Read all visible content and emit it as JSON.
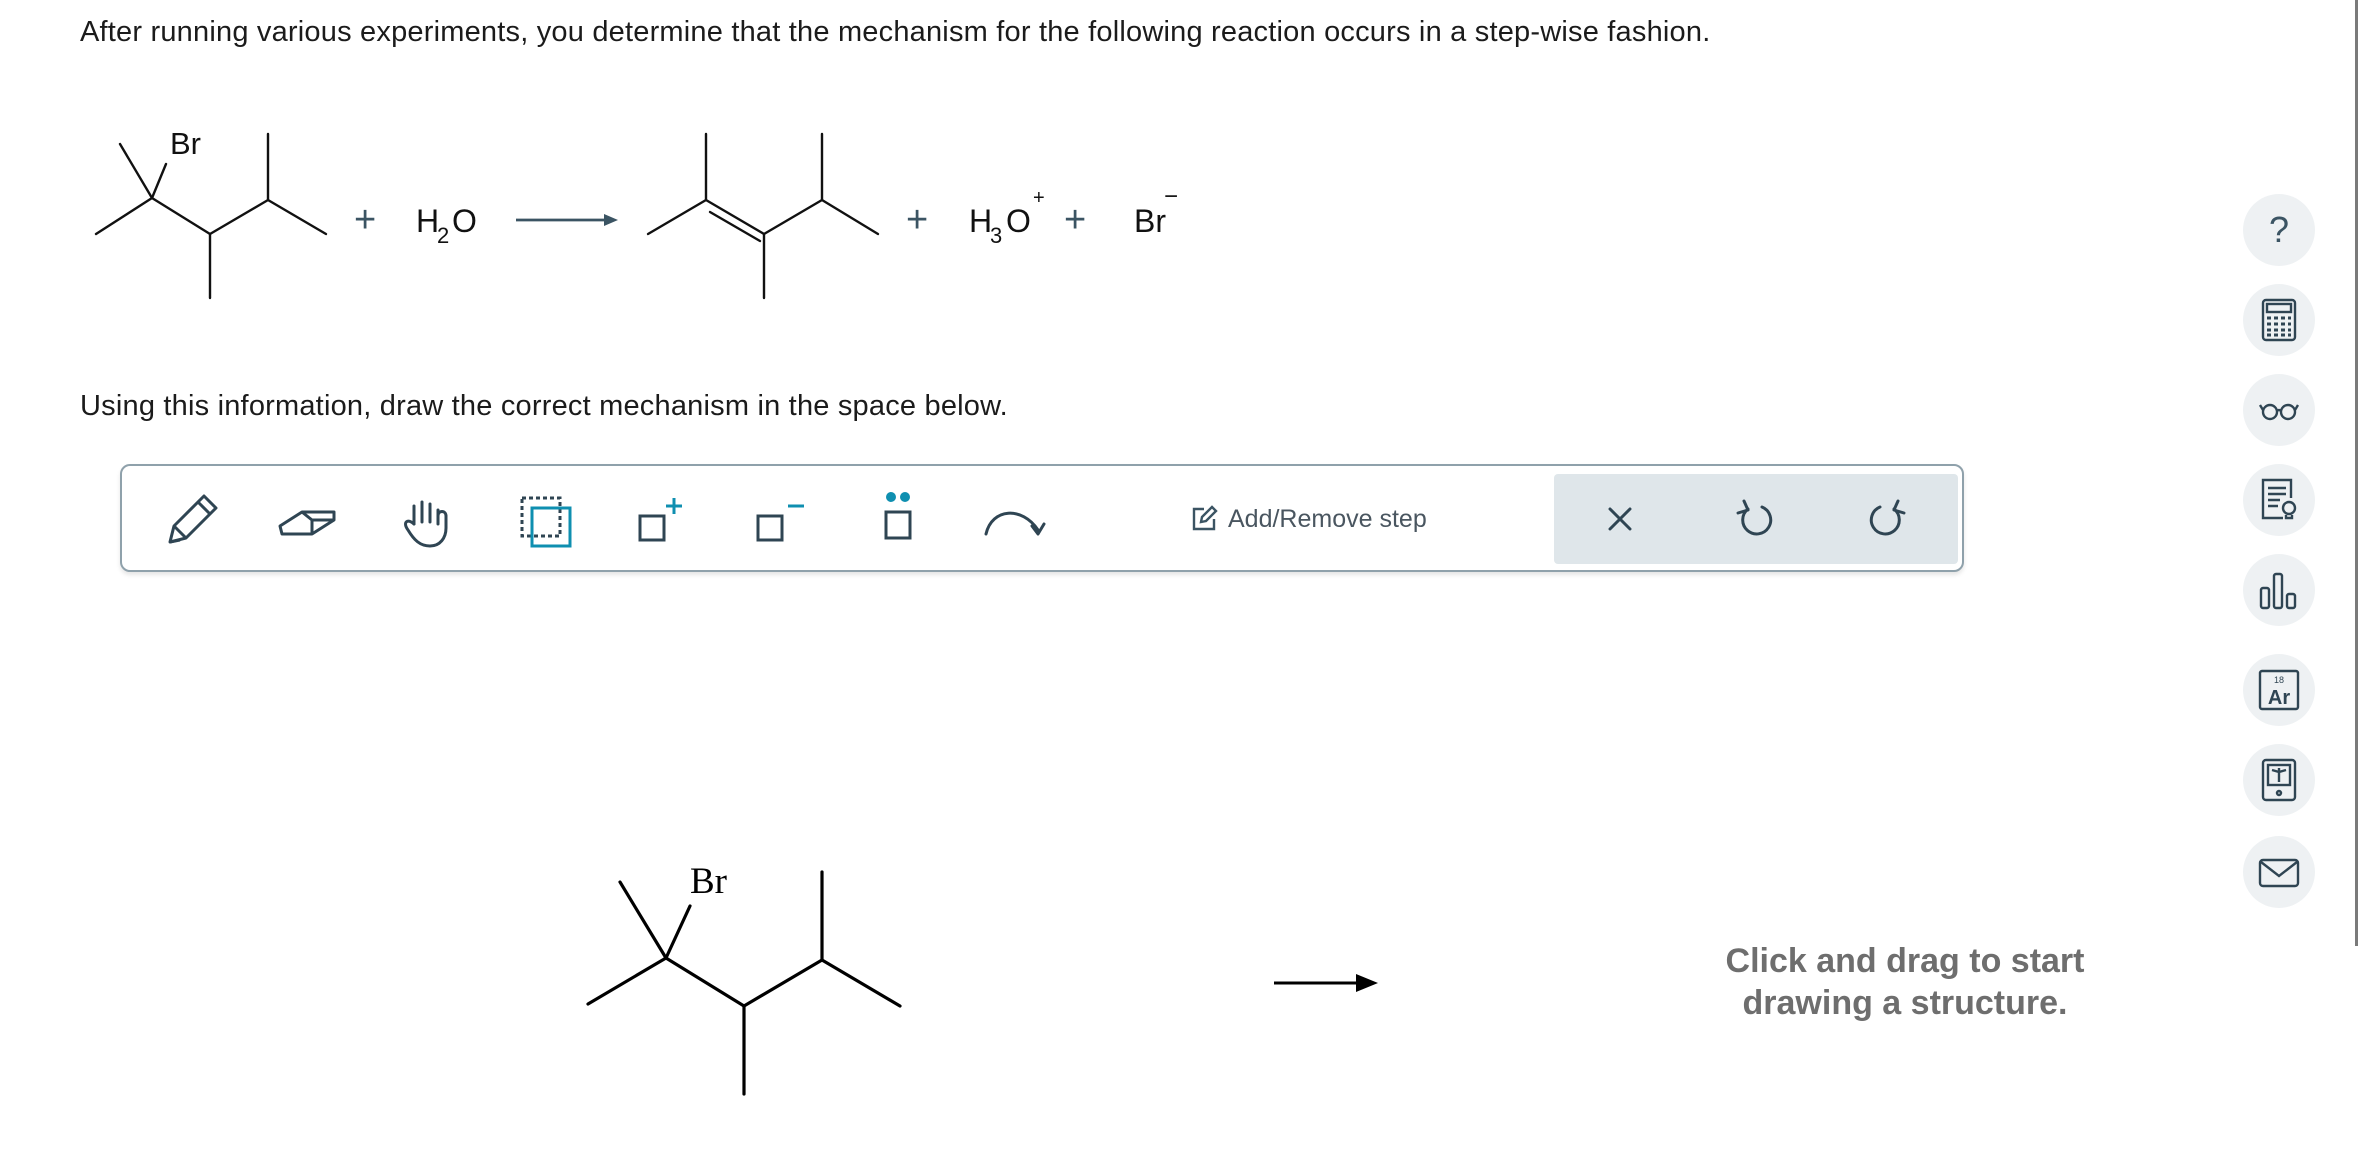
{
  "question": {
    "text": "After running various experiments, you determine that the mechanism for the following reaction occurs in a step-wise fashion."
  },
  "reaction": {
    "reactant_label": "Br",
    "reagent_plus": "+",
    "water": "H",
    "water_sub": "2",
    "water_o": "O",
    "product_plus_1": "+",
    "hydronium": "H",
    "hydronium_sub": "3",
    "hydronium_o": "O",
    "hydronium_charge": "+",
    "product_plus_2": "+",
    "bromide": "Br",
    "bromide_charge": "−"
  },
  "instruction": {
    "text": "Using this information, draw the correct mechanism in the space below."
  },
  "toolbar": {
    "tools": [
      "pencil-icon",
      "eraser-icon",
      "hand-icon",
      "selection-icon",
      "add-charge-icon",
      "remove-charge-icon",
      "lone-pair-icon",
      "curved-arrow-icon"
    ],
    "add_remove_step_label": "Add/Remove step",
    "actions": [
      "close-icon",
      "undo-icon",
      "redo-icon"
    ],
    "accent": "#0f8fb0"
  },
  "canvas": {
    "structure_label": "Br",
    "hint_line1": "Click and drag to start",
    "hint_line2": "drawing a structure."
  },
  "sidebar": {
    "buttons": [
      "help-icon",
      "calculator-icon",
      "glasses-icon",
      "hint-icon",
      "chart-icon",
      "periodic-table-icon",
      "textbook-icon",
      "mail-icon"
    ],
    "help_label": "?",
    "periodic_number": "18",
    "periodic_symbol": "Ar"
  }
}
